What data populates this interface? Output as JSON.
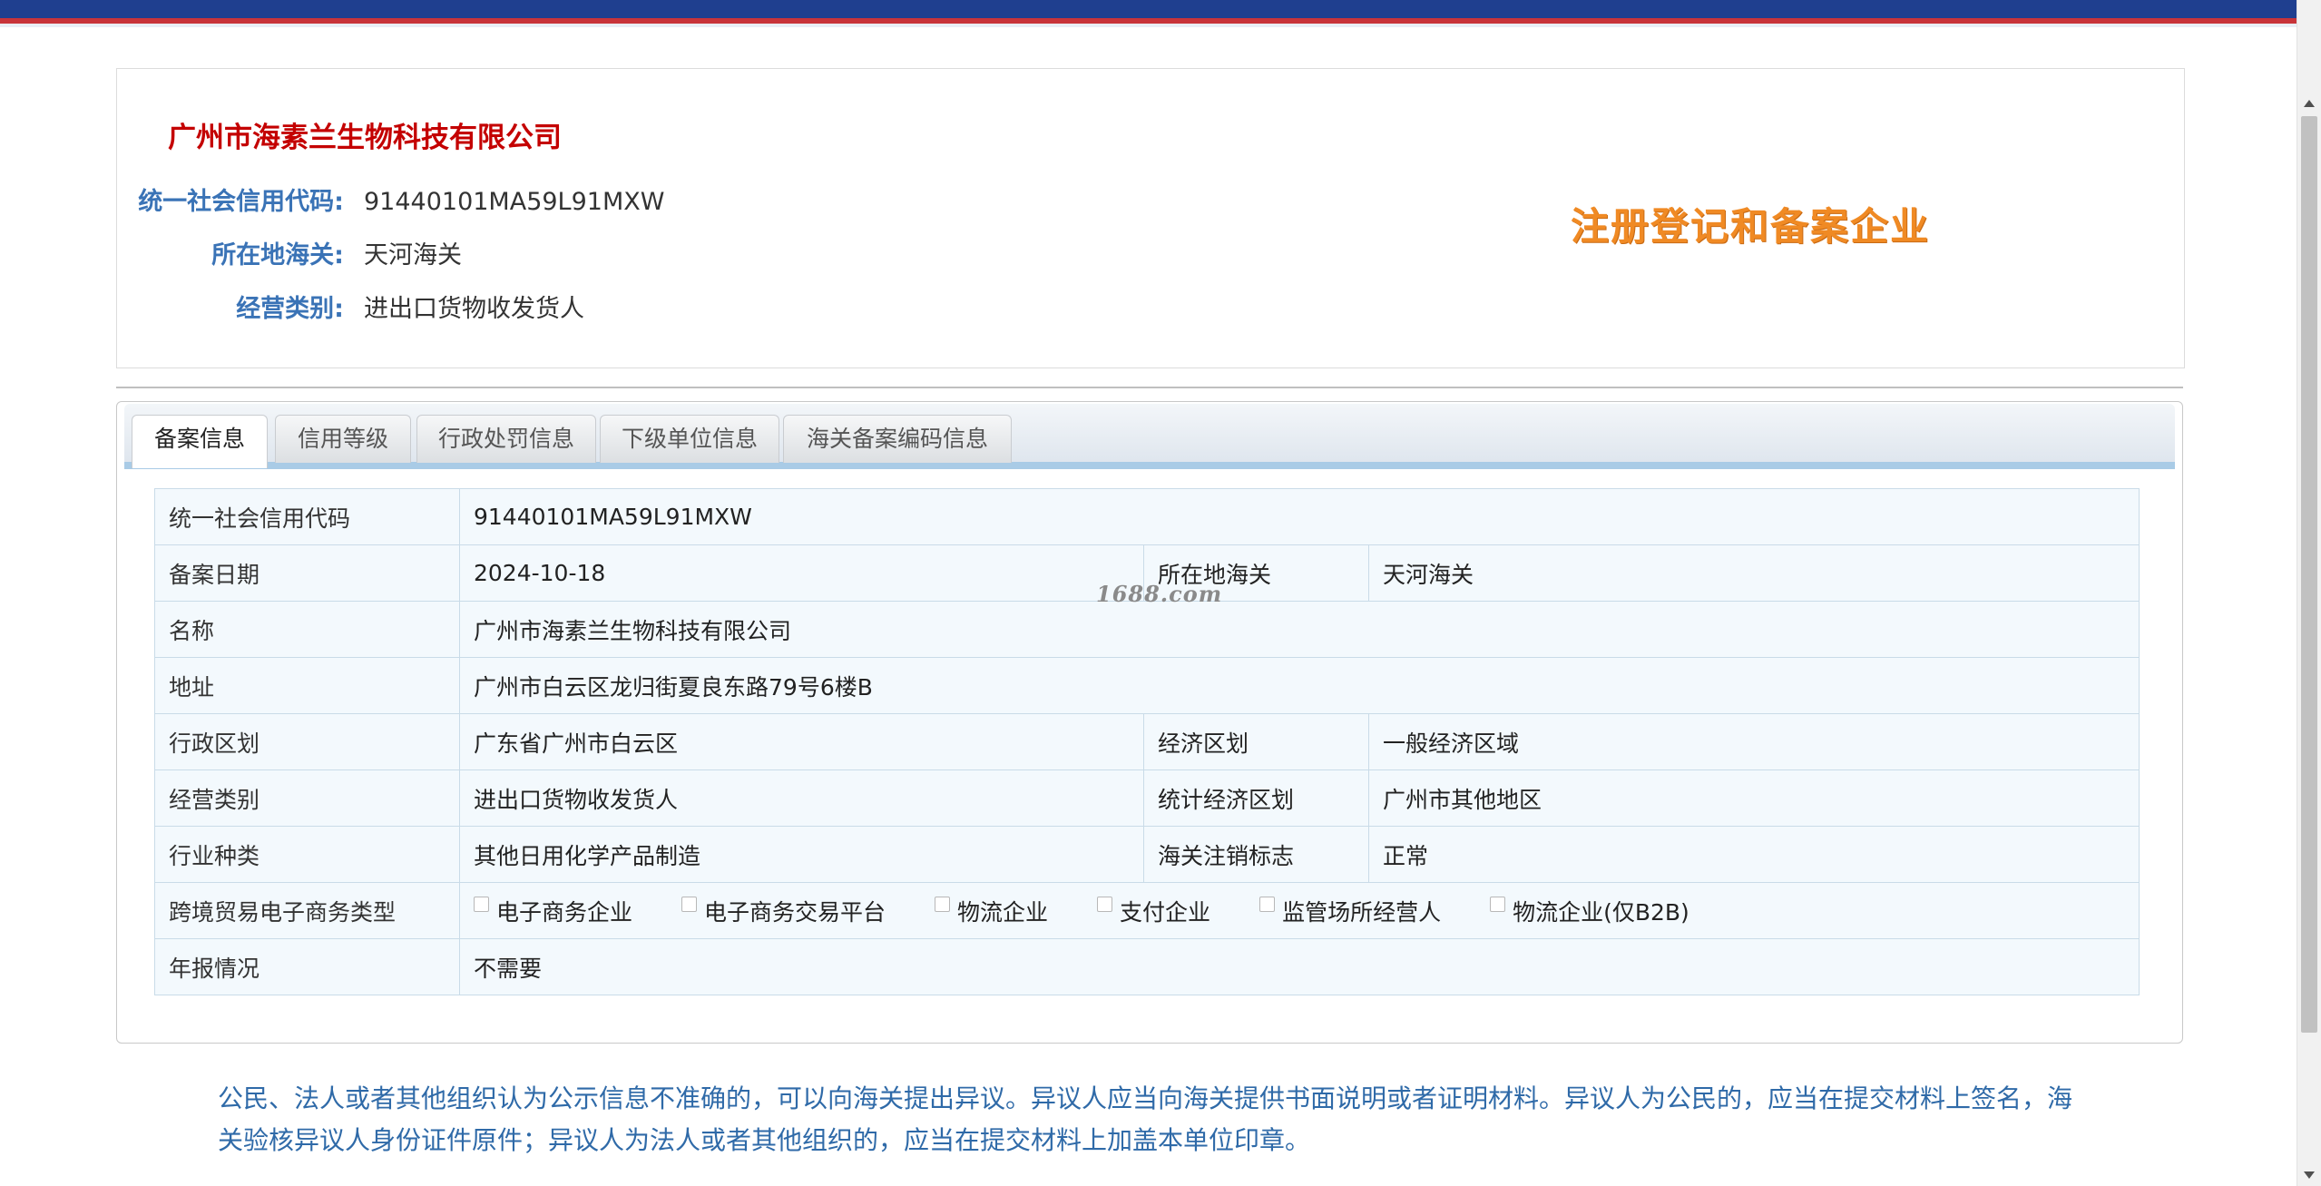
{
  "header": {
    "company_name": "广州市海素兰生物科技有限公司",
    "credit_code_label": "统一社会信用代码:",
    "credit_code": "91440101MA59L91MXW",
    "customs_label": "所在地海关:",
    "customs": "天河海关",
    "business_type_label": "经营类别:",
    "business_type": "进出口货物收发货人",
    "stamp": "注册登记和备案企业"
  },
  "tabs": [
    {
      "label": "备案信息",
      "active": true
    },
    {
      "label": "信用等级",
      "active": false
    },
    {
      "label": "行政处罚信息",
      "active": false
    },
    {
      "label": "下级单位信息",
      "active": false
    },
    {
      "label": "海关备案编码信息",
      "active": false
    }
  ],
  "table": {
    "credit_code_key": "统一社会信用代码",
    "credit_code_val": "91440101MA59L91MXW",
    "record_date_key": "备案日期",
    "record_date_val": "2024-10-18",
    "customs_key": "所在地海关",
    "customs_val": "天河海关",
    "name_key": "名称",
    "name_val": "广州市海素兰生物科技有限公司",
    "address_key": "地址",
    "address_val": "广州市白云区龙归街夏良东路79号6楼B",
    "admin_region_key": "行政区划",
    "admin_region_val": "广东省广州市白云区",
    "econ_region_key": "经济区划",
    "econ_region_val": "一般经济区域",
    "business_type_key": "经营类别",
    "business_type_val": "进出口货物收发货人",
    "stat_region_key": "统计经济区划",
    "stat_region_val": "广州市其他地区",
    "industry_key": "行业种类",
    "industry_val": "其他日用化学产品制造",
    "cancel_flag_key": "海关注销标志",
    "cancel_flag_val": "正常",
    "ecommerce_key": "跨境贸易电子商务类型",
    "ecommerce_options": [
      "电子商务企业",
      "电子商务交易平台",
      "物流企业",
      "支付企业",
      "监管场所经营人",
      "物流企业(仅B2B)"
    ],
    "annual_report_key": "年报情况",
    "annual_report_val": "不需要"
  },
  "watermark": "1688.com",
  "notice": "公民、法人或者其他组织认为公示信息不准确的，可以向海关提出异议。异议人应当向海关提供书面说明或者证明材料。异议人为公民的，应当在提交材料上签名，海关验核异议人身份证件原件；异议人为法人或者其他组织的，应当在提交材料上加盖本单位印章。",
  "colors": {
    "top_bar": "#1f3f8f",
    "top_bar_stripe": "#c8343a",
    "company_name": "#c40000",
    "label_blue": "#3a73b6",
    "stamp_orange": "#f08a24",
    "notice_blue": "#2f6aa8",
    "table_bg": "#f3f9fd"
  }
}
